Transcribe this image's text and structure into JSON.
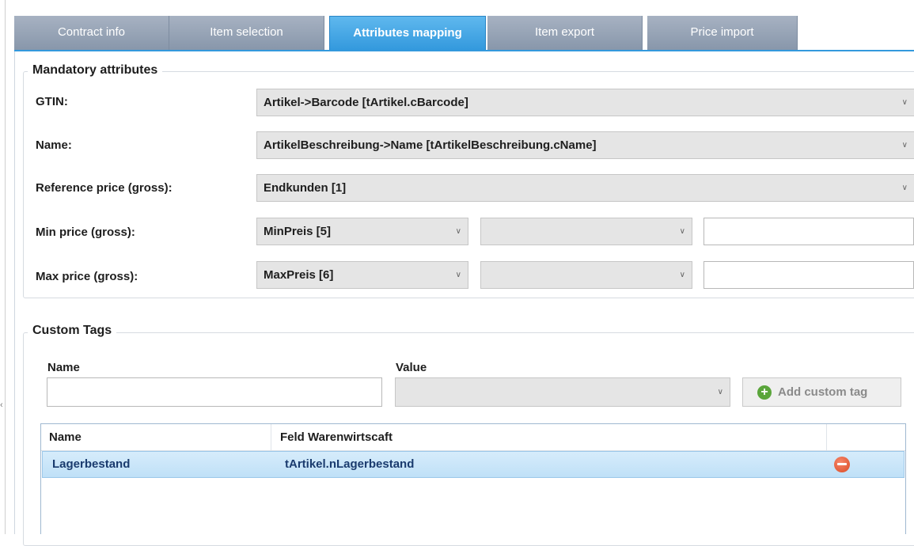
{
  "tabs": [
    {
      "label": "Contract info",
      "active": false
    },
    {
      "label": "Item selection",
      "active": false
    },
    {
      "label": "Attributes mapping",
      "active": true
    },
    {
      "label": "Item export",
      "active": false
    },
    {
      "label": "Price import",
      "active": false
    }
  ],
  "mandatory": {
    "title": "Mandatory attributes",
    "gtin": {
      "label": "GTIN:",
      "value": "Artikel->Barcode [tArtikel.cBarcode]"
    },
    "name": {
      "label": "Name:",
      "value": "ArtikelBeschreibung->Name [tArtikelBeschreibung.cName]"
    },
    "reference_price": {
      "label": "Reference price (gross):",
      "value": "Endkunden [1]"
    },
    "min_price": {
      "label": "Min price (gross):",
      "value": "MinPreis [5]",
      "second_value": "",
      "text_value": ""
    },
    "max_price": {
      "label": "Max price (gross):",
      "value": "MaxPreis [6]",
      "second_value": "",
      "text_value": ""
    }
  },
  "custom_tags": {
    "title": "Custom Tags",
    "name_label": "Name",
    "name_value": "",
    "value_label": "Value",
    "value_selected": "",
    "add_button": "Add custom tag",
    "grid": {
      "columns": [
        "Name",
        "Feld Warenwirtscaft"
      ],
      "rows": [
        {
          "name": "Lagerbestand",
          "field": "tArtikel.nLagerbestand",
          "selected": true
        }
      ]
    }
  },
  "icons": {
    "chevron": "chevron-down-icon",
    "add": "plus-circle-icon",
    "remove": "minus-circle-icon"
  },
  "colors": {
    "active_tab": "#3399dd",
    "inactive_tab": "#97a4b6",
    "selected_row": "#c9e5f8"
  }
}
